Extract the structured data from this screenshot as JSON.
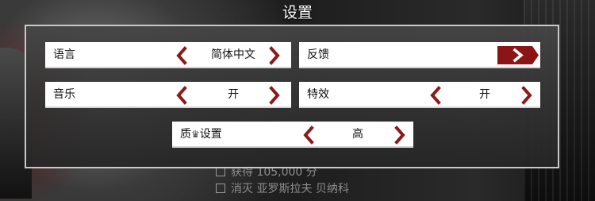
{
  "title": "设置",
  "settings": {
    "language": {
      "label": "语言",
      "value": "简体中文"
    },
    "feedback": {
      "label": "反馈"
    },
    "music": {
      "label": "音乐",
      "value": "开"
    },
    "effects": {
      "label": "特效",
      "value": "开"
    },
    "quality": {
      "label_prefix": "质",
      "label_suffix": "设置",
      "value": "高"
    }
  },
  "background": {
    "objectives": [
      "获得 105,000 分",
      "消灭 亚罗斯拉夫 贝纳科"
    ]
  },
  "colors": {
    "accent": "#8b1a1a",
    "feedback_button": "#8b1416",
    "row_bg": "#ffffff",
    "panel_border": "#c8c8c8"
  },
  "icons": {
    "prev": "chevron-left-icon",
    "next": "chevron-right-icon",
    "feedback": "arrow-right-icon"
  }
}
